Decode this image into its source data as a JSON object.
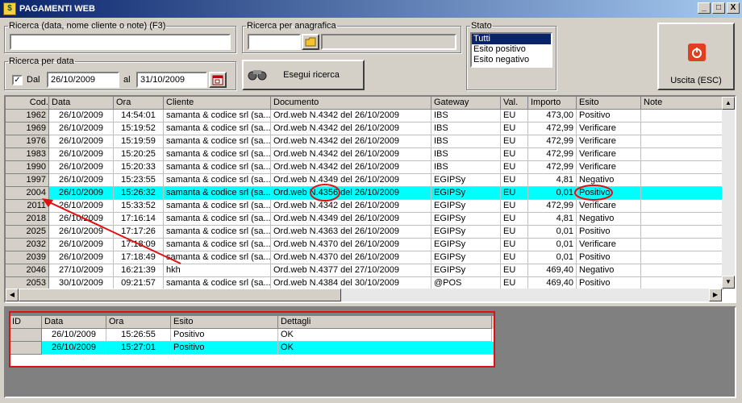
{
  "window": {
    "title": "PAGAMENTI WEB",
    "min": "_",
    "max": "□",
    "close": "X"
  },
  "search": {
    "main_label": "Ricerca (data, nome cliente o note) (F3)",
    "main_value": "",
    "anagrafica_label": "Ricerca per anagrafica",
    "anagrafica_value": "",
    "date_label": "Ricerca per data",
    "dal_label": "Dal",
    "dal_checked": true,
    "date_from": "26/10/2009",
    "al_label": "al",
    "date_to": "31/10/2009",
    "run_label": "Esegui ricerca"
  },
  "stato": {
    "label": "Stato",
    "options": [
      "Tutti",
      "Esito positivo",
      "Esito negativo"
    ],
    "selected": "Tutti"
  },
  "exit_label": "Uscita (ESC)",
  "main_table": {
    "headers": [
      "Cod.",
      "Data",
      "Ora",
      "Cliente",
      "Documento",
      "Gateway",
      "Val.",
      "Importo",
      "Esito",
      "Note"
    ],
    "rows": [
      [
        "1962",
        "26/10/2009",
        "14:54:01",
        "samanta & codice srl (sa...",
        "Ord.web N.4342 del 26/10/2009",
        "IBS",
        "EU",
        "473,00",
        "Positivo",
        ""
      ],
      [
        "1969",
        "26/10/2009",
        "15:19:52",
        "samanta & codice srl (sa...",
        "Ord.web N.4342 del 26/10/2009",
        "IBS",
        "EU",
        "472,99",
        "Verificare",
        ""
      ],
      [
        "1976",
        "26/10/2009",
        "15:19:59",
        "samanta & codice srl (sa...",
        "Ord.web N.4342 del 26/10/2009",
        "IBS",
        "EU",
        "472,99",
        "Verificare",
        ""
      ],
      [
        "1983",
        "26/10/2009",
        "15:20:25",
        "samanta & codice srl (sa...",
        "Ord.web N.4342 del 26/10/2009",
        "IBS",
        "EU",
        "472,99",
        "Verificare",
        ""
      ],
      [
        "1990",
        "26/10/2009",
        "15:20:33",
        "samanta & codice srl (sa...",
        "Ord.web N.4342 del 26/10/2009",
        "IBS",
        "EU",
        "472,99",
        "Verificare",
        ""
      ],
      [
        "1997",
        "26/10/2009",
        "15:23:55",
        "samanta & codice srl (sa...",
        "Ord.web N.4349 del 26/10/2009",
        "EGIPSy",
        "EU",
        "4,81",
        "Negativo",
        ""
      ],
      [
        "2004",
        "26/10/2009",
        "15:26:32",
        "samanta & codice srl (sa...",
        "Ord.web N.4356 del 26/10/2009",
        "EGIPSy",
        "EU",
        "0,01",
        "Positivo",
        ""
      ],
      [
        "2011",
        "26/10/2009",
        "15:33:52",
        "samanta & codice srl (sa...",
        "Ord.web N.4342 del 26/10/2009",
        "EGIPSy",
        "EU",
        "472,99",
        "Verificare",
        ""
      ],
      [
        "2018",
        "26/10/2009",
        "17:16:14",
        "samanta & codice srl (sa...",
        "Ord.web N.4349 del 26/10/2009",
        "EGIPSy",
        "EU",
        "4,81",
        "Negativo",
        ""
      ],
      [
        "2025",
        "26/10/2009",
        "17:17:26",
        "samanta & codice srl (sa...",
        "Ord.web N.4363 del 26/10/2009",
        "EGIPSy",
        "EU",
        "0,01",
        "Positivo",
        ""
      ],
      [
        "2032",
        "26/10/2009",
        "17:18:09",
        "samanta & codice srl (sa...",
        "Ord.web N.4370 del 26/10/2009",
        "EGIPSy",
        "EU",
        "0,01",
        "Verificare",
        ""
      ],
      [
        "2039",
        "26/10/2009",
        "17:18:49",
        "samanta & codice srl (sa...",
        "Ord.web N.4370 del 26/10/2009",
        "EGIPSy",
        "EU",
        "0,01",
        "Positivo",
        ""
      ],
      [
        "2046",
        "27/10/2009",
        "16:21:39",
        "hkh",
        "Ord.web N.4377 del 27/10/2009",
        "EGIPSy",
        "EU",
        "469,40",
        "Negativo",
        ""
      ],
      [
        "2053",
        "30/10/2009",
        "09:21:57",
        "samanta & codice srl (sa...",
        "Ord.web N.4384 del 30/10/2009",
        "@POS",
        "EU",
        "469,40",
        "Positivo",
        ""
      ]
    ],
    "selected_index": 6
  },
  "detail_table": {
    "headers": [
      "ID",
      "Data",
      "Ora",
      "Esito",
      "Dettagli"
    ],
    "rows": [
      [
        "",
        "26/10/2009",
        "15:26:55",
        "Positivo",
        "OK"
      ],
      [
        "",
        "26/10/2009",
        "15:27:01",
        "Positivo",
        "OK"
      ]
    ],
    "selected_index": 1
  },
  "colors": {
    "title_start": "#0a246a",
    "selected_row": "#00ffff",
    "annotation": "#e01010"
  }
}
